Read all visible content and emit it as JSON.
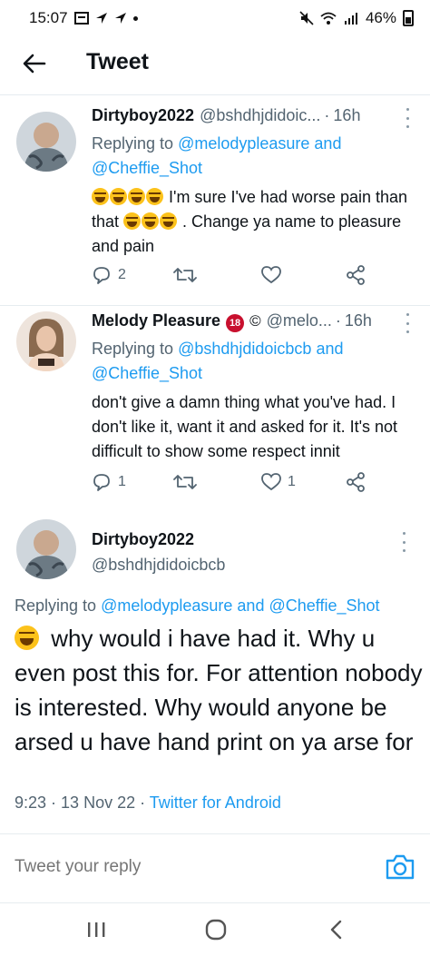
{
  "status_bar": {
    "time": "15:07",
    "battery": "46%",
    "icons": [
      "gallery-icon",
      "navigation-arrow-icon",
      "navigation-arrow-icon",
      "dot-icon",
      "mute-icon",
      "wifi-icon",
      "signal-icon",
      "battery-icon"
    ]
  },
  "header": {
    "title": "Tweet",
    "back_icon": "back-arrow-icon"
  },
  "tweets": [
    {
      "name": "Dirtyboy2022",
      "handle": "@bshdhjdidoic...",
      "time": "16h",
      "reply_prefix": "Replying to ",
      "reply_to_1": "@melodypleasure",
      "reply_and": " and",
      "reply_to_2": "@Cheffie_Shot",
      "text_a": " I'm sure I've had worse pain than that ",
      "text_b": " . Change ya name to pleasure and pain",
      "reply_count": "2",
      "retweet_count": "",
      "like_count": ""
    },
    {
      "name": "Melody Pleasure",
      "badge": "18",
      "copyright": "©",
      "handle": "@melo...",
      "time": "16h",
      "reply_prefix": "Replying to ",
      "reply_to_1": "@bshdhjdidoicbcb",
      "reply_and": " and",
      "reply_to_2": "@Cheffie_Shot",
      "text": "don't give a damn thing what you've had. I don't like it, want it and asked for it. It's not difficult to show some respect innit",
      "reply_count": "1",
      "retweet_count": "",
      "like_count": "1"
    }
  ],
  "main_tweet": {
    "name": "Dirtyboy2022",
    "handle": "@bshdhjdidoicbcb",
    "reply_prefix": "Replying to ",
    "reply_to_1": "@melodypleasure",
    "reply_and": " and ",
    "reply_to_2": "@Cheffie_Shot",
    "text": " why would i have had it. Why u even post this for. For attention nobody is interested. Why would anyone be arsed u have hand print on ya arse for",
    "time": "9:23",
    "date": "13 Nov 22",
    "source": "Twitter for Android"
  },
  "reply_box": {
    "placeholder": "Tweet your reply"
  },
  "colors": {
    "accent": "#1d9bf0",
    "muted": "#536471",
    "text": "#0f1419",
    "divider": "#e6ecf0"
  }
}
